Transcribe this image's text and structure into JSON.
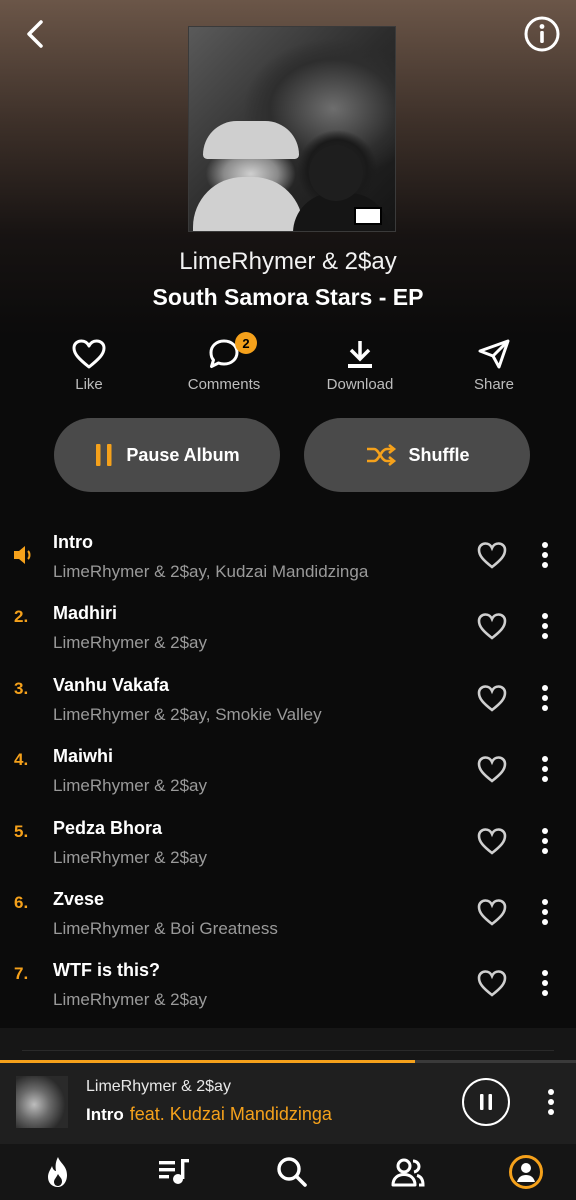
{
  "colors": {
    "accent": "#f5a11b",
    "background": "#0b0b0b",
    "pill": "#4a4a4a",
    "muted_text": "#9a9a9a"
  },
  "header": {
    "back_icon": "chevron-left-icon",
    "info_icon": "info-circle-icon"
  },
  "album": {
    "artist": "LimeRhymer & 2$ay",
    "title": "South Samora Stars - EP"
  },
  "actions": [
    {
      "label": "Like",
      "icon": "heart-outline-icon"
    },
    {
      "label": "Comments",
      "icon": "comment-bubble-icon",
      "badge": "2"
    },
    {
      "label": "Download",
      "icon": "download-icon"
    },
    {
      "label": "Share",
      "icon": "send-icon"
    }
  ],
  "controls": {
    "pause_label": "Pause Album",
    "shuffle_label": "Shuffle"
  },
  "tracks": [
    {
      "number": "",
      "playing": true,
      "title": "Intro",
      "artists": "LimeRhymer & 2$ay, Kudzai Mandidzinga"
    },
    {
      "number": "2.",
      "title": "Madhiri",
      "artists": "LimeRhymer & 2$ay"
    },
    {
      "number": "3.",
      "title": "Vanhu Vakafa",
      "artists": "LimeRhymer & 2$ay, Smokie Valley"
    },
    {
      "number": "4.",
      "title": "Maiwhi",
      "artists": "LimeRhymer & 2$ay"
    },
    {
      "number": "5.",
      "title": "Pedza Bhora",
      "artists": "LimeRhymer & 2$ay"
    },
    {
      "number": "6.",
      "title": "Zvese",
      "artists": "LimeRhymer & Boi Greatness"
    },
    {
      "number": "7.",
      "title": "WTF is this?",
      "artists": "LimeRhymer & 2$ay"
    }
  ],
  "now_playing": {
    "artist": "LimeRhymer & 2$ay",
    "track": "Intro",
    "feat": "feat. Kudzai Mandidzinga",
    "progress": 0.72
  },
  "bottom_nav": [
    {
      "name": "fire-icon"
    },
    {
      "name": "playlist-icon"
    },
    {
      "name": "search-icon"
    },
    {
      "name": "people-icon"
    },
    {
      "name": "profile-icon",
      "active": true
    }
  ]
}
